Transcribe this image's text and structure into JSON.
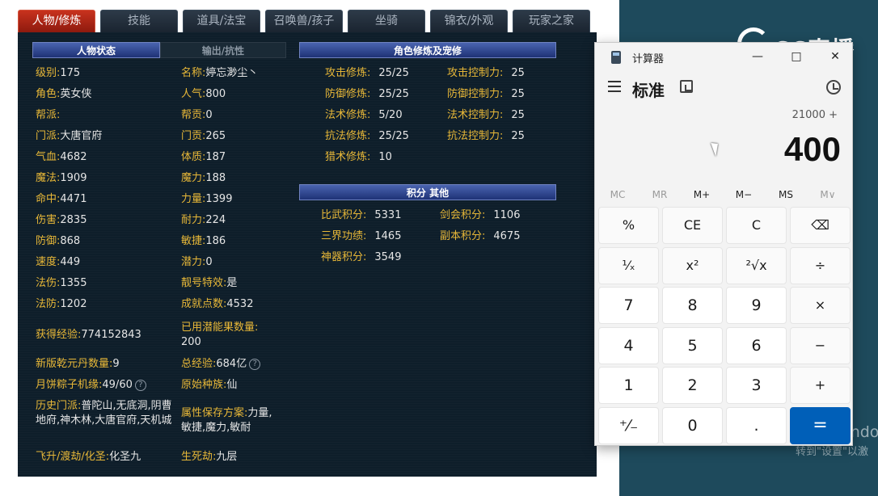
{
  "tabs": [
    "人物/修炼",
    "技能",
    "道具/法宝",
    "召唤兽/孩子",
    "坐骑",
    "锦衣/外观",
    "玩家之家"
  ],
  "left_panel": {
    "headers": [
      "人物状态",
      "输出/抗性"
    ],
    "rows": [
      {
        "l1": "级别:",
        "v1": "175",
        "l2": "名称:",
        "v2": "婷忘渺尘丶"
      },
      {
        "l1": "角色:",
        "v1": "英女侠",
        "l2": "人气:",
        "v2": "800"
      },
      {
        "l1": "帮派:",
        "v1": "",
        "l2": "帮贡:",
        "v2": "0"
      },
      {
        "l1": "门派:",
        "v1": "大唐官府",
        "l2": "门贡:",
        "v2": "265"
      },
      {
        "l1": "气血:",
        "v1": "4682",
        "l2": "体质:",
        "v2": "187"
      },
      {
        "l1": "魔法:",
        "v1": "1909",
        "l2": "魔力:",
        "v2": "188"
      },
      {
        "l1": "命中:",
        "v1": "4471",
        "l2": "力量:",
        "v2": "1399"
      },
      {
        "l1": "伤害:",
        "v1": "2835",
        "l2": "耐力:",
        "v2": "224"
      },
      {
        "l1": "防御:",
        "v1": "868",
        "l2": "敏捷:",
        "v2": "186"
      },
      {
        "l1": "速度:",
        "v1": "449",
        "l2": "潜力:",
        "v2": "0"
      },
      {
        "l1": "法伤:",
        "v1": "1355",
        "l2": "靓号特效:",
        "v2": "是"
      },
      {
        "l1": "法防:",
        "v1": "1202",
        "l2": "成就点数:",
        "v2": "4532"
      }
    ],
    "extra": {
      "exp_label": "获得经验:",
      "exp_value": "774152843",
      "potential_label": "已用潜能果数量:",
      "potential_value": "200",
      "qianyuan_label": "新版乾元丹数量:",
      "qianyuan_value": "9",
      "total_exp_label": "总经验:",
      "total_exp_value": "684亿",
      "mooncake_label": "月饼粽子机缘:",
      "mooncake_value": "49/60",
      "race_label": "原始种族:",
      "race_value": "仙",
      "history_label": "历史门派:",
      "history_value": "普陀山,无底洞,阴曹地府,神木林,大唐官府,天机城",
      "attr_label": "属性保存方案:",
      "attr_value": "力量,敏捷,魔力,敏耐",
      "ascend_label": "飞升/渡劫/化圣:",
      "ascend_value": "化圣九",
      "life_label": "生死劫:",
      "life_value": "九层",
      "help": "?"
    }
  },
  "cultivation": {
    "header": "角色修炼及宠修",
    "rows": [
      {
        "l1": "攻击修炼:",
        "v1": "25/25",
        "l2": "攻击控制力:",
        "v2": "25"
      },
      {
        "l1": "防御修炼:",
        "v1": "25/25",
        "l2": "防御控制力:",
        "v2": "25"
      },
      {
        "l1": "法术修炼:",
        "v1": "5/20",
        "l2": "法术控制力:",
        "v2": "25"
      },
      {
        "l1": "抗法修炼:",
        "v1": "25/25",
        "l2": "抗法控制力:",
        "v2": "25"
      },
      {
        "l1": "猎术修炼:",
        "v1": "10",
        "l2": "",
        "v2": ""
      }
    ]
  },
  "points": {
    "header": "积分 其他",
    "rows": [
      {
        "l1": "比武积分:",
        "v1": "5331",
        "l2": "剑会积分:",
        "v2": "1106"
      },
      {
        "l1": "三界功绩:",
        "v1": "1465",
        "l2": "副本积分:",
        "v2": "4675"
      },
      {
        "l1": "神器积分:",
        "v1": "3549",
        "l2": "",
        "v2": ""
      }
    ]
  },
  "calculator": {
    "title": "计算器",
    "mode": "标准",
    "expression": "21000 +",
    "display": "400",
    "window_buttons": [
      "—",
      "□",
      "✕"
    ],
    "memory": [
      "MC",
      "MR",
      "M+",
      "M−",
      "MS",
      "M∨"
    ],
    "keys": [
      [
        "%",
        "CE",
        "C",
        "⌫"
      ],
      [
        "¹⁄ₓ",
        "x²",
        "²√x",
        "÷"
      ],
      [
        "7",
        "8",
        "9",
        "×"
      ],
      [
        "4",
        "5",
        "6",
        "−"
      ],
      [
        "1",
        "2",
        "3",
        "+"
      ],
      [
        "⁺⁄₋",
        "0",
        ".",
        "="
      ]
    ]
  },
  "overlay": {
    "watermark": "CC直播",
    "activate_line1": "激活 Windo",
    "activate_line2": "转到\"设置\"以激"
  },
  "colors": {
    "label": "#e8b838",
    "value": "#e6e6e6",
    "panel_bg": "#0e1e2a",
    "active_tab": "#c8321e",
    "equals_key": "#005fb8"
  }
}
